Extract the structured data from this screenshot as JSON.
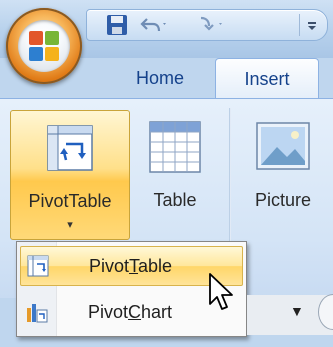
{
  "quick_access": {
    "icons": [
      "save-icon",
      "undo-icon",
      "redo-icon",
      "customize-dropdown-icon"
    ]
  },
  "tabs": [
    {
      "label": "Home",
      "active": false
    },
    {
      "label": "Insert",
      "active": true
    }
  ],
  "ribbon": {
    "pivottable_button": {
      "label": "PivotTable",
      "icon": "pivottable-icon",
      "state": "pressed"
    },
    "table_button": {
      "label": "Table",
      "icon": "table-grid-icon"
    },
    "picture_button": {
      "label": "Picture",
      "icon": "picture-icon"
    }
  },
  "dropdown_menu": {
    "items": [
      {
        "label": "PivotTable",
        "accelerator": "T",
        "icon": "pivottable-small-icon",
        "highlighted": true
      },
      {
        "label": "PivotChart",
        "accelerator": "C",
        "icon": "pivotchart-icon",
        "highlighted": false
      }
    ]
  },
  "colors": {
    "ribbon_bg": "#d4e4f6",
    "tab_text": "#15428b",
    "hover_highlight": "#ffd668",
    "office_button_orange": "#e07a16"
  }
}
